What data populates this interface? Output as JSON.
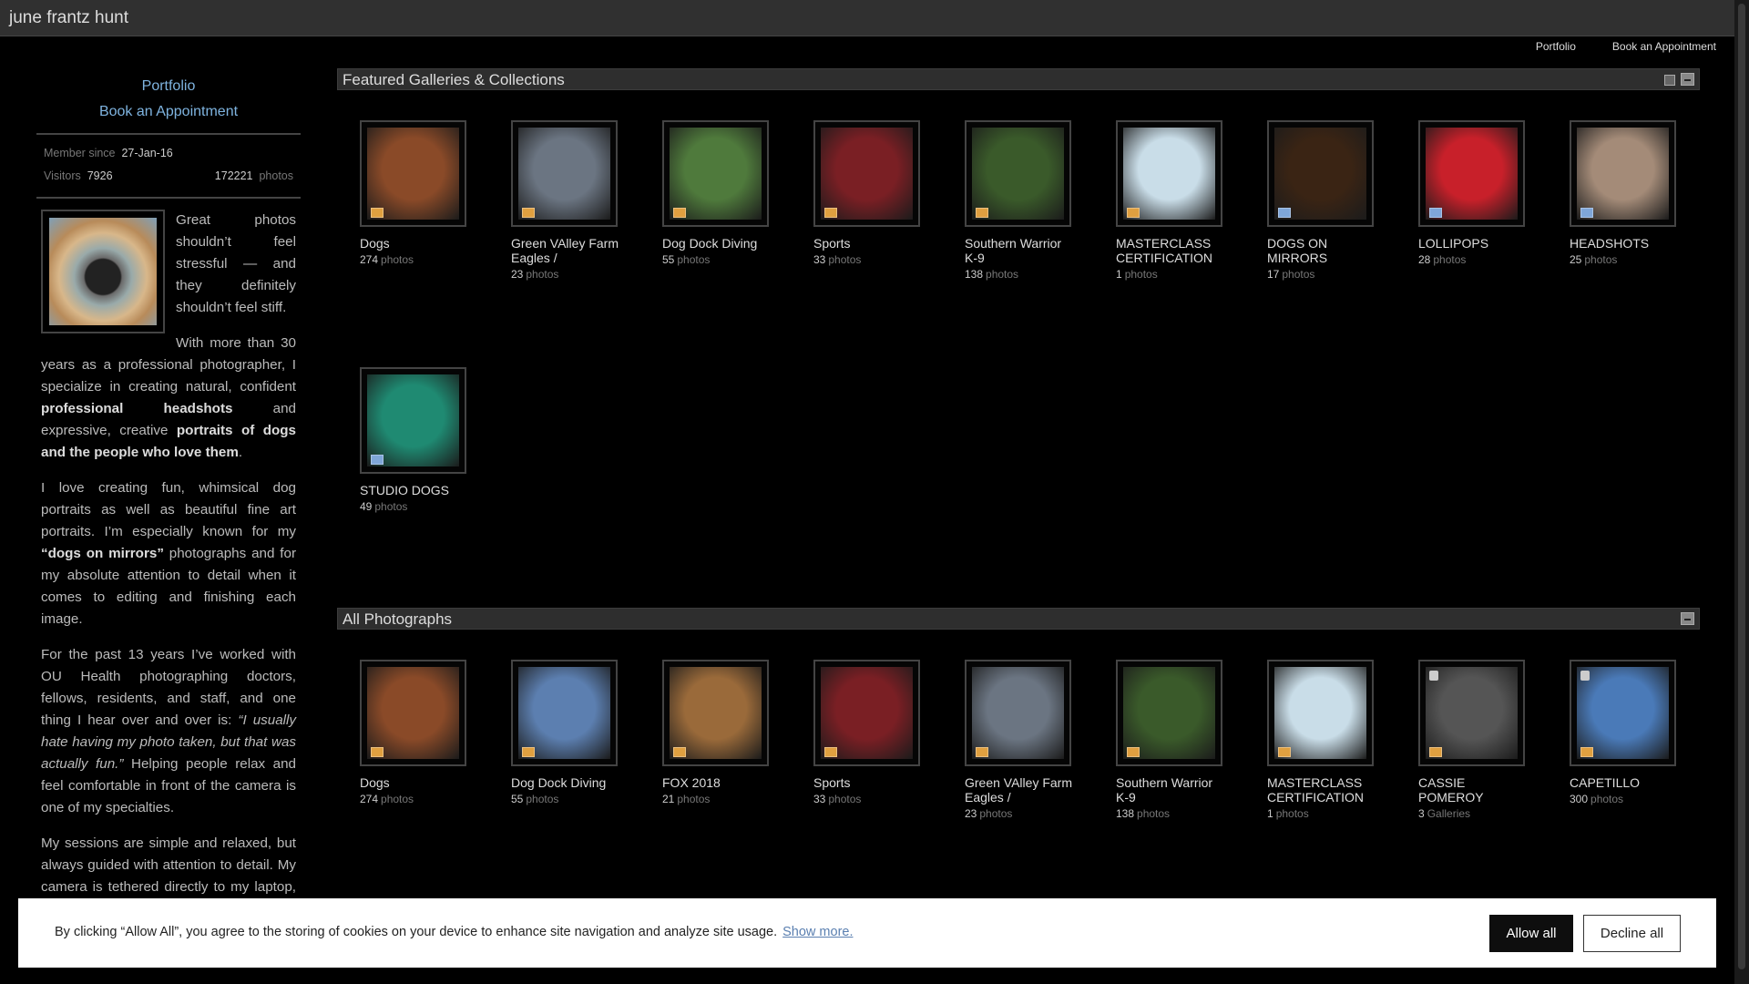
{
  "header": {
    "site_title": "june frantz hunt",
    "nav": [
      "Portfolio",
      "Book an Appointment"
    ]
  },
  "sidebar": {
    "links": [
      "Portfolio",
      "Book an Appointment"
    ],
    "member_label": "Member since",
    "member_value": "27-Jan-16",
    "visitors_label": "Visitors",
    "visitors_value": "7926",
    "photos_value": "172221",
    "photos_label": "photos",
    "bio_p1": "Great photos shouldn’t feel stressful — and they definitely shouldn’t feel stiff.",
    "bio_p2_a": "With more than 30 years as a professional photographer, I specialize in creating natural, confident ",
    "bio_p2_b1": "professional headshots",
    "bio_p2_c": " and expressive, creative ",
    "bio_p2_b2": "portraits of dogs and the people who love them",
    "bio_p2_d": ".",
    "bio_p3_a": "I love creating fun, whimsical dog portraits as well as beautiful fine art portraits. I’m especially known for my ",
    "bio_p3_b": "“dogs on mirrors”",
    "bio_p3_c": " photographs and for my absolute attention to detail when it comes to editing and finishing each image.",
    "bio_p4_a": "For the past 13 years I’ve worked with OU Health photographing doctors, fellows, residents, and staff, and one thing I hear over and over is: ",
    "bio_p4_b": "“I usually hate having my photo taken, but that was actually fun.”",
    "bio_p4_c": " Helping people relax and feel comfortable in front of the camera is one of my specialties.",
    "bio_p5": "My sessions are simple and relaxed, but always guided with attention to detail. My camera is tethered directly to my laptop, so you can see your images live and then we refine from there. I’ll keep"
  },
  "featured": {
    "title": "Featured Galleries & Collections",
    "items": [
      {
        "title": "Dogs",
        "count": "274",
        "unit": "photos",
        "badge": "orange",
        "color": "#8a4a28"
      },
      {
        "title": "Green VAlley Farm Eagles /",
        "count": "23",
        "unit": "photos",
        "badge": "orange",
        "color": "#6b7582"
      },
      {
        "title": "Dog Dock Diving",
        "count": "55",
        "unit": "photos",
        "badge": "orange",
        "color": "#4f7a3c"
      },
      {
        "title": "Sports",
        "count": "33",
        "unit": "photos",
        "badge": "orange",
        "color": "#7a1f24"
      },
      {
        "title": "Southern Warrior K-9",
        "count": "138",
        "unit": "photos",
        "badge": "orange",
        "color": "#3a5a2a"
      },
      {
        "title": "MASTERCLASS CERTIFICATION",
        "count": "1",
        "unit": "photos",
        "badge": "orange",
        "color": "#c9dde8"
      },
      {
        "title": "DOGS ON MIRRORS",
        "count": "17",
        "unit": "photos",
        "badge": "blue",
        "color": "#3a2414"
      },
      {
        "title": "LOLLIPOPS",
        "count": "28",
        "unit": "photos",
        "badge": "blue",
        "color": "#c8202a"
      },
      {
        "title": "HEADSHOTS",
        "count": "25",
        "unit": "photos",
        "badge": "blue",
        "color": "#a48b78"
      },
      {
        "title": "STUDIO DOGS",
        "count": "49",
        "unit": "photos",
        "badge": "blue",
        "color": "#1f8a72"
      }
    ]
  },
  "all_photos": {
    "title": "All Photographs",
    "items": [
      {
        "title": "Dogs",
        "count": "274",
        "unit": "photos",
        "badge": "orange",
        "color": "#8a4a28"
      },
      {
        "title": "Dog Dock Diving",
        "count": "55",
        "unit": "photos",
        "badge": "orange",
        "color": "#5c7fb0"
      },
      {
        "title": "FOX 2018",
        "count": "21",
        "unit": "photos",
        "badge": "orange",
        "color": "#9a6a3a"
      },
      {
        "title": "Sports",
        "count": "33",
        "unit": "photos",
        "badge": "orange",
        "color": "#7a1f24"
      },
      {
        "title": "Green VAlley Farm Eagles /",
        "count": "23",
        "unit": "photos",
        "badge": "orange",
        "color": "#6b7582"
      },
      {
        "title": "Southern Warrior K-9",
        "count": "138",
        "unit": "photos",
        "badge": "orange",
        "color": "#3a5a2a"
      },
      {
        "title": "MASTERCLASS CERTIFICATION",
        "count": "1",
        "unit": "photos",
        "badge": "orange",
        "color": "#c9dde8"
      },
      {
        "title": "CASSIE POMEROY",
        "count": "3",
        "unit": "Galleries",
        "badge": "orange",
        "locked": true,
        "color": "#555555"
      },
      {
        "title": "CAPETILLO",
        "count": "300",
        "unit": "photos",
        "badge": "orange",
        "locked": true,
        "color": "#4a7ab8"
      }
    ]
  },
  "cookie": {
    "message": "By clicking “Allow All”, you agree to the storing of cookies on your device to enhance site navigation and analyze site usage.",
    "show_more": "Show more.",
    "allow": "Allow all",
    "decline": "Decline all"
  }
}
